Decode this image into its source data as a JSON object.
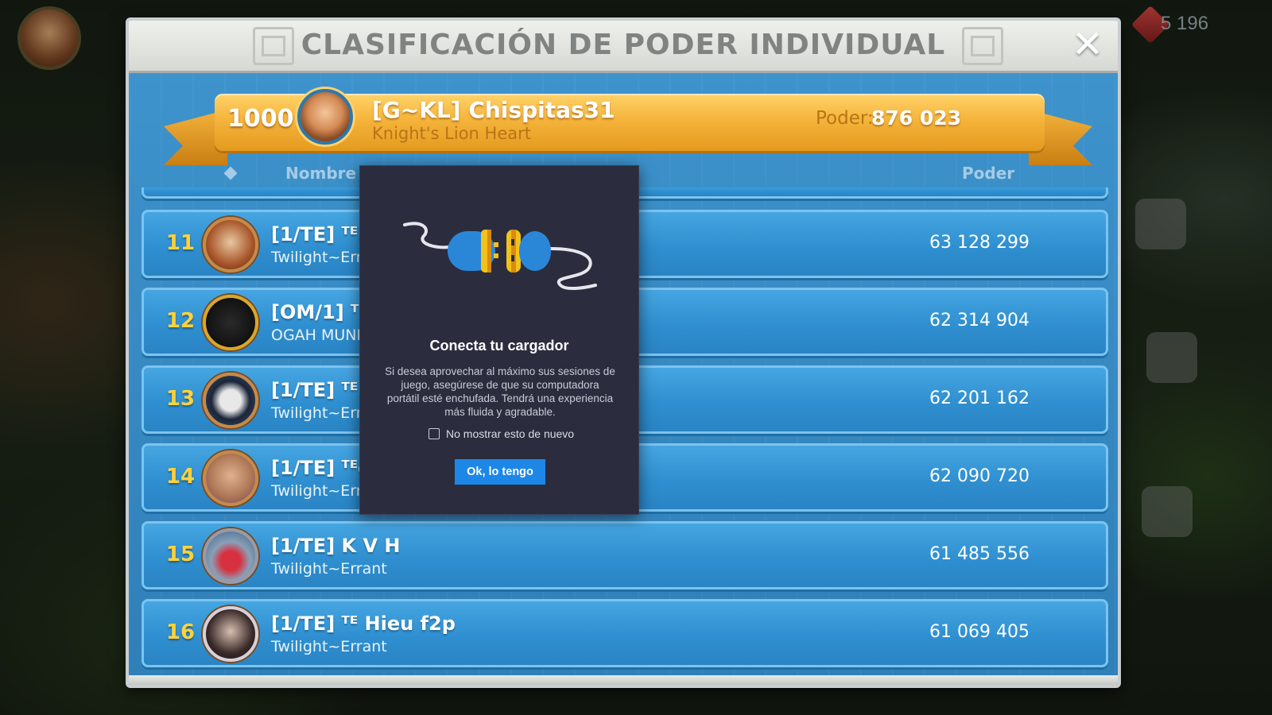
{
  "background": {
    "gems_count": "5 196"
  },
  "panel": {
    "title": "CLASIFICACIÓN DE PODER INDIVIDUAL",
    "close_label": "✕"
  },
  "my_entry": {
    "rank": "1000+",
    "name": "[G~KL] Chispitas31",
    "alliance": "Knight's Lion Heart",
    "power_label": "Poder:",
    "power_value": "876 023"
  },
  "columns": {
    "name": "Nombre",
    "power": "Poder"
  },
  "rows": [
    {
      "rank": "11",
      "name": "[1/TE] ᵀᴱKI",
      "alliance": "Twilight~Errar",
      "power": "63 128 299",
      "avatar_color": "#a8552a"
    },
    {
      "rank": "12",
      "name": "[OM/1] ᵀᴱB",
      "alliance": "OGAH MUNDU",
      "power": "62 314 904",
      "avatar_color": "#1a1a1a"
    },
    {
      "rank": "13",
      "name": "[1/TE] ᵀᴱ N",
      "alliance": "Twilight~Errar",
      "power": "62 201 162",
      "avatar_color": "#2a3c5a"
    },
    {
      "rank": "14",
      "name": "[1/TE] ᵀᴱde",
      "alliance": "Twilight~Errar",
      "power": "62 090 720",
      "avatar_color": "#b07a58"
    },
    {
      "rank": "15",
      "name": "[1/TE] K V H",
      "alliance": "Twilight~Errant",
      "power": "61 485 556",
      "avatar_color": "#5a7a9a"
    },
    {
      "rank": "16",
      "name": "[1/TE] ᵀᴱ Hieu f2p",
      "alliance": "Twilight~Errant",
      "power": "61 069 405",
      "avatar_color": "#3a2a2a"
    }
  ],
  "modal": {
    "title": "Conecta tu cargador",
    "body": "Si desea aprovechar al máximo sus sesiones de juego, asegúrese de que su computadora portátil esté enchufada. Tendrá una experiencia más fluida y agradable.",
    "checkbox_label": "No mostrar esto de nuevo",
    "checkbox_checked": false,
    "ok_label": "Ok, lo tengo"
  },
  "colors": {
    "accent_blue": "#1d87e8",
    "rank_gold": "#ffd23a",
    "ribbon_gold": "#f5b43b",
    "modal_bg": "#2b2d3f"
  }
}
